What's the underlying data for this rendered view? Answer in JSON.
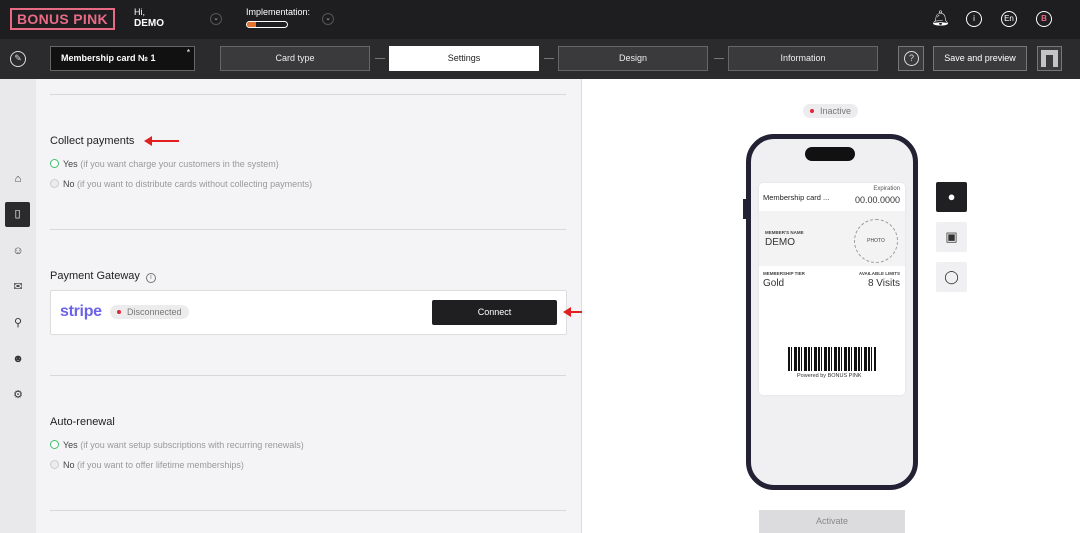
{
  "header": {
    "logo": "BONUS PINK",
    "greeting": "Hi,",
    "user": "DEMO",
    "implementation_label": "Implementation:",
    "implementation_progress": 0.22,
    "language": "En",
    "avatar_initial": "B",
    "info_glyph": "i"
  },
  "toolbar": {
    "card_name": "Membership card № 1",
    "steps": [
      "Card type",
      "Settings",
      "Design",
      "Information"
    ],
    "active_step": "Settings",
    "help_glyph": "?",
    "save_label": "Save and preview"
  },
  "settings": {
    "collect_payments": {
      "title": "Collect payments",
      "yes_label": "Yes",
      "yes_hint": "(if you want charge your customers in the system)",
      "no_label": "No",
      "no_hint": "(if you want to distribute cards without collecting payments)",
      "selected": "yes"
    },
    "payment_gateway": {
      "title": "Payment Gateway",
      "provider": "stripe",
      "status": "Disconnected",
      "connect_label": "Connect"
    },
    "auto_renewal": {
      "title": "Auto-renewal",
      "yes_label": "Yes",
      "yes_hint": "(if you want setup subscriptions with recurring renewals)",
      "no_label": "No",
      "no_hint": "(if you want to offer lifetime memberships)",
      "selected": "yes"
    }
  },
  "preview": {
    "status": "Inactive",
    "card": {
      "name": "Membership card ...",
      "expiration_label": "Expiration",
      "expiration_value": "00.00.0000",
      "member_name_label": "MEMBER'S NAME",
      "member_name": "DEMO",
      "photo_label": "PHOTO",
      "tier_label": "MEMBERSHIP TIER",
      "tier": "Gold",
      "limits_label": "AVAILABLE LIMITS",
      "limits": "8 Visits",
      "powered_by": "Powered by BONUS PINK"
    },
    "activate_label": "Activate"
  },
  "colors": {
    "brand_pink": "#e86b85",
    "stripe_purple": "#6c63e6",
    "radio_green": "#3fbf6a",
    "annotation_red": "#e02020",
    "progress_orange": "#e2742e"
  }
}
